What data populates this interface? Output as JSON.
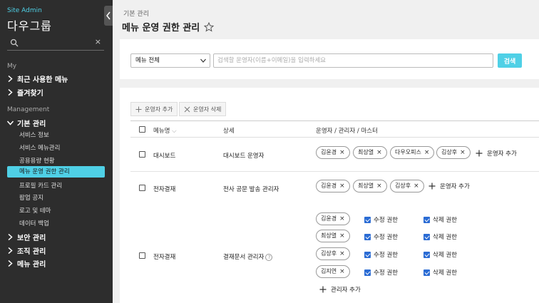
{
  "sidebar": {
    "brand_small": "Site Admin",
    "brand_title": "다우그룹",
    "search_clear": "×",
    "section_my": "My",
    "recent_menus": "최근 사용한 메뉴",
    "favorites": "즐겨찾기",
    "section_management": "Management",
    "basic_management": "기본 관리",
    "sub_items": [
      "서비스 정보",
      "서비스 메뉴관리",
      "공용용량 현황",
      "메뉴 운영 권한 관리",
      "프로필 카드 관리",
      "팝업 공지",
      "로고 및 테마",
      "데이터 백업"
    ],
    "security_management": "보안 관리",
    "org_management": "조직 관리",
    "menu_management": "메뉴 관리"
  },
  "header": {
    "breadcrumb": "기본 관리",
    "title": "메뉴 운영 권한 관리"
  },
  "filter": {
    "select_value": "메뉴 전체",
    "search_placeholder": "검색할 운영자(이름+이메일)을 입력하세요",
    "search_button": "검색"
  },
  "toolbar": {
    "add_operator": "운영자 추가",
    "delete_operator": "운영자 삭제"
  },
  "table": {
    "headers": {
      "menu_name": "메뉴명",
      "detail": "상세",
      "operators": "운영자 / 관리자 / 마스터"
    },
    "rows": [
      {
        "menu": "대시보드",
        "detail": "대시보드 운영자",
        "chips": [
          "김윤경",
          "최상열",
          "다우오피스",
          "김상후"
        ],
        "add_label": "운영자 추가"
      },
      {
        "menu": "전자결재",
        "detail": "전사 공문 발송 관리자",
        "chips": [
          "김윤경",
          "최상열",
          "김상후"
        ],
        "add_label": "운영자 추가"
      },
      {
        "menu": "전자결재",
        "detail": "결재문서 관리자",
        "chips": [
          "김윤경",
          "최상열",
          "김상후",
          "김지연"
        ],
        "edit_label": "수정 권한",
        "delete_label": "삭제 권한",
        "add_label": "관리자 추가"
      }
    ],
    "chip_remove": "×"
  },
  "colors": {
    "accent": "#4fd0e6",
    "sidebar_bg": "#2d2d2d",
    "checkbox_on": "#2b6cd4"
  }
}
